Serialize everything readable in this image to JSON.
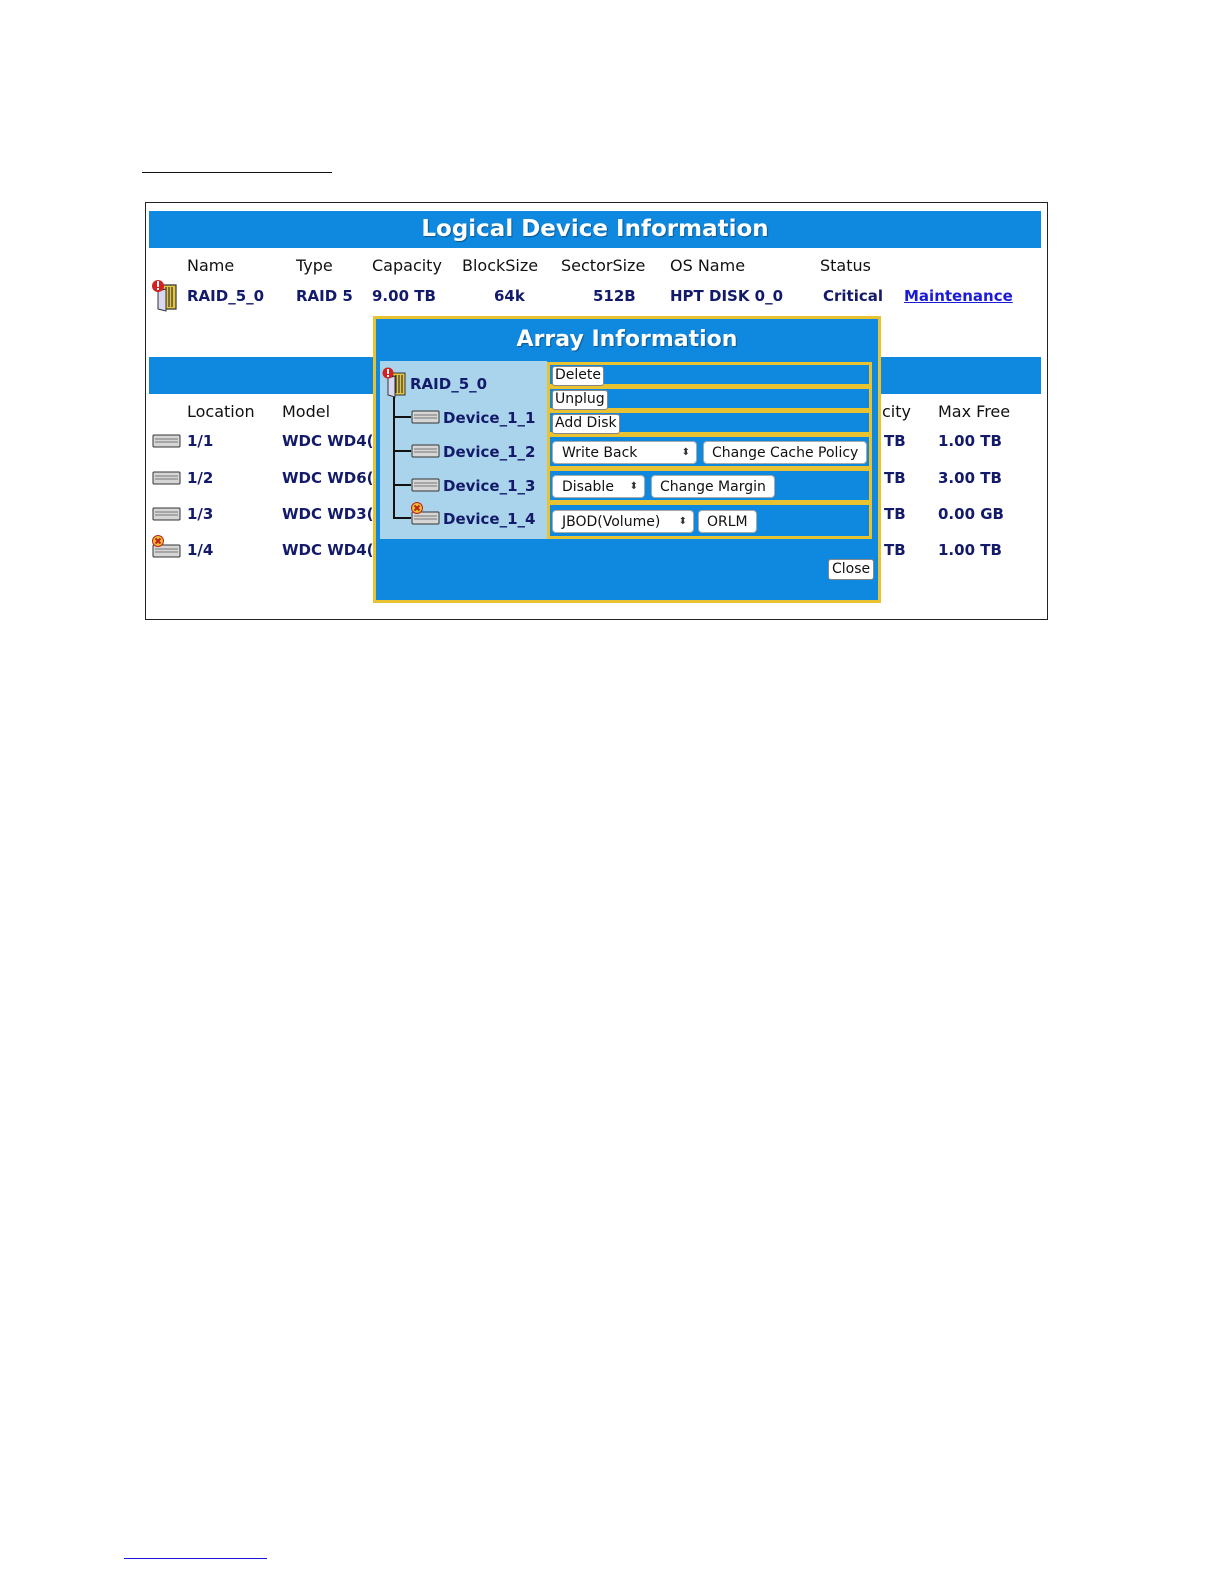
{
  "logical": {
    "title": "Logical Device Information",
    "headers": [
      "Name",
      "Type",
      "Capacity",
      "BlockSize",
      "SectorSize",
      "OS Name",
      "Status"
    ],
    "row": {
      "name": "RAID_5_0",
      "type": "RAID 5",
      "capacity": "9.00 TB",
      "blocksize": "64k",
      "sectorsize": "512B",
      "os_name": "HPT DISK 0_0",
      "status": "Critical",
      "action": "Maintenance"
    }
  },
  "physical": {
    "headers": {
      "location": "Location",
      "model": "Model",
      "capacity_partial": "city",
      "max_free": "Max Free"
    },
    "rows": [
      {
        "location": "1/1",
        "model_partial": "WDC WD4(",
        "cap_partial": "TB",
        "max_free": "1.00 TB",
        "icon": "disk-icon"
      },
      {
        "location": "1/2",
        "model_partial": "WDC WD6(",
        "cap_partial": "TB",
        "max_free": "3.00 TB",
        "icon": "disk-icon"
      },
      {
        "location": "1/3",
        "model_partial": "WDC WD3(",
        "cap_partial": "TB",
        "max_free": "0.00 GB",
        "icon": "disk-icon"
      },
      {
        "location": "1/4",
        "model_partial": "WDC WD4(",
        "cap_partial": "TB",
        "max_free": "1.00 TB",
        "icon": "failed-disk-icon"
      }
    ]
  },
  "modal": {
    "title": "Array Information",
    "array_name": "RAID_5_0",
    "devices": [
      "Device_1_1",
      "Device_1_2",
      "Device_1_3",
      "Device_1_4"
    ],
    "actions": {
      "delete": "Delete",
      "unplug": "Unplug",
      "add_disk": "Add Disk",
      "cache_policy_selected": "Write Back",
      "change_cache_policy": "Change Cache Policy",
      "margin_selected": "Disable",
      "change_margin": "Change Margin",
      "orlm_selected": "JBOD(Volume)",
      "orlm": "ORLM",
      "close": "Close"
    }
  },
  "colors": {
    "banner": "#0f88e0",
    "modal_border": "#e8c230",
    "tree_bg": "#a9d4ec",
    "value_text": "#131a6a",
    "link": "#1a1ad8"
  }
}
